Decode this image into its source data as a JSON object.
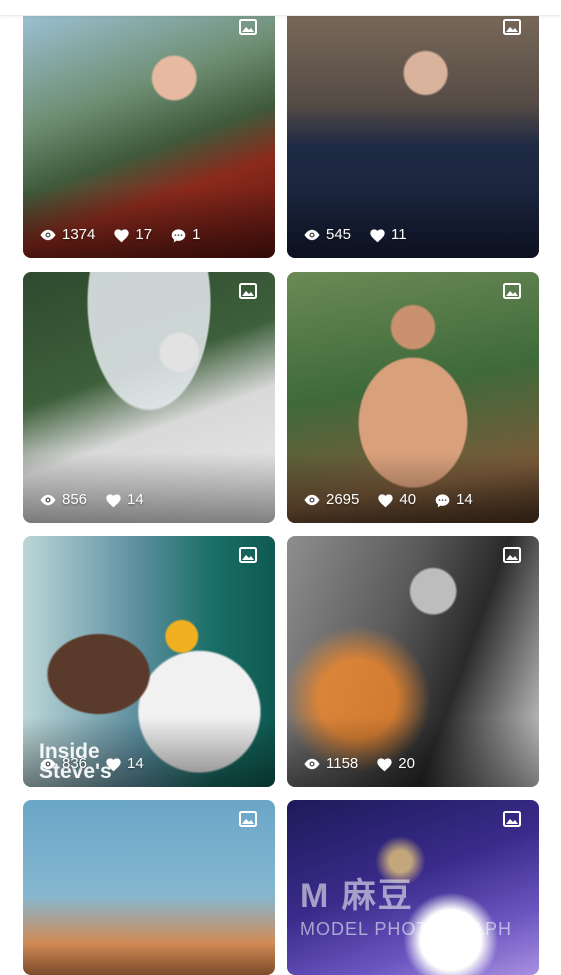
{
  "cards": [
    {
      "views": "1374",
      "likes": "17",
      "comments": "1",
      "has_comments": true
    },
    {
      "views": "545",
      "likes": "11",
      "comments": "",
      "has_comments": false
    },
    {
      "views": "856",
      "likes": "14",
      "comments": "",
      "has_comments": false
    },
    {
      "views": "2695",
      "likes": "40",
      "comments": "14",
      "has_comments": true
    },
    {
      "views": "836",
      "likes": "14",
      "comments": "",
      "has_comments": false,
      "overlay_text": "Inside Steve's"
    },
    {
      "views": "1158",
      "likes": "20",
      "comments": "",
      "has_comments": false
    },
    {
      "views": "",
      "likes": "",
      "comments": "",
      "has_comments": false
    },
    {
      "views": "",
      "likes": "",
      "comments": "",
      "has_comments": false
    }
  ],
  "watermark": {
    "main": "M 麻豆",
    "sub": "MODEL PHOTOGRAPH"
  },
  "icons": {
    "image_badge": "image-icon",
    "views": "eye-icon",
    "likes": "heart-icon",
    "comments": "comment-icon"
  },
  "colors": {
    "stat_text": "#ffffff",
    "page_background": "#ffffff"
  }
}
